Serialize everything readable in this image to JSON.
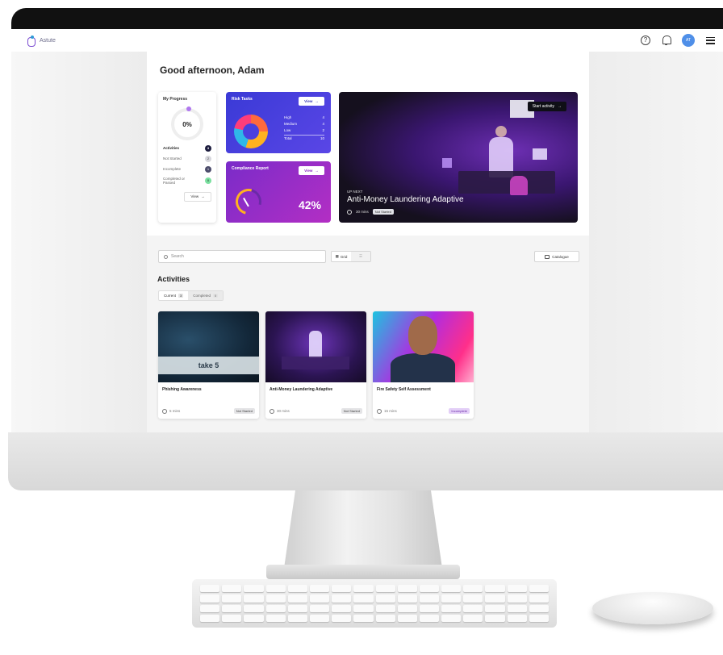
{
  "app": {
    "brand": "Astute"
  },
  "topbar": {
    "help_glyph": "?",
    "avatar_initials": "AT"
  },
  "greeting": "Good afternoon, Adam",
  "progress": {
    "title": "My Progress",
    "percent": "0%",
    "activities_label": "Activities",
    "activities_count": "3",
    "rows": [
      {
        "label": "Not Started",
        "count": "2"
      },
      {
        "label": "Incomplete",
        "count": "1"
      },
      {
        "label": "Completed or Passed",
        "count": "0"
      }
    ],
    "view_label": "View"
  },
  "risk_tasks": {
    "title": "Risk Tasks",
    "view_label": "View",
    "rows": [
      {
        "label": "High",
        "value": "4"
      },
      {
        "label": "Medium",
        "value": "4"
      },
      {
        "label": "Low",
        "value": "2"
      },
      {
        "label": "Total",
        "value": "10"
      }
    ],
    "colors": [
      "#ff6a3d",
      "#ffb21f",
      "#2fb7e8",
      "#ff3d7a"
    ]
  },
  "compliance": {
    "title": "Compliance Report",
    "view_label": "View",
    "percent": "42%"
  },
  "up_next": {
    "button": "Start activity",
    "eyebrow": "UP NEXT",
    "title": "Anti-Money Laundering Adaptive",
    "duration": "30 mins",
    "status": "Not Started"
  },
  "toolbar": {
    "search_placeholder": "Search",
    "grid_label": "Grid",
    "catalogue_label": "Catalogue"
  },
  "activities": {
    "title": "Activities",
    "tabs": [
      {
        "label": "Current",
        "count": "3"
      },
      {
        "label": "Completed",
        "count": "0"
      }
    ],
    "cards": [
      {
        "name": "Phishing Awareness",
        "duration": "5 mins",
        "status": "Not Started",
        "thumb_text": "take 5"
      },
      {
        "name": "Anti-Money Laundering Adaptive",
        "duration": "30 mins",
        "status": "Not Started"
      },
      {
        "name": "Fire Safety Self Assessment",
        "duration": "15 mins",
        "status": "Incomplete"
      }
    ]
  }
}
